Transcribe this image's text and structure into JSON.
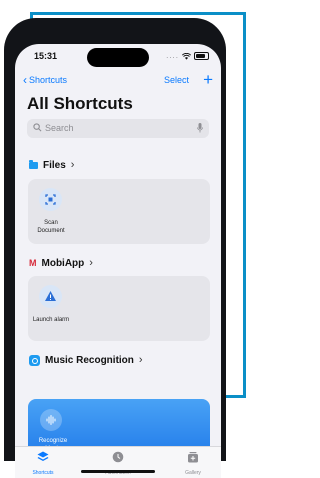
{
  "status": {
    "time": "15:31",
    "dots": "...."
  },
  "nav": {
    "back_label": "Shortcuts",
    "select_label": "Select",
    "add_label": "+"
  },
  "title": "All Shortcuts",
  "search": {
    "placeholder": "Search"
  },
  "sections": [
    {
      "title": "Files",
      "tiles": [
        {
          "label": "Scan Document",
          "icon": "scan-document-icon"
        }
      ]
    },
    {
      "title": "MobiApp",
      "tiles": [
        {
          "label": "Launch alarm",
          "icon": "warning-icon"
        }
      ]
    },
    {
      "title": "Music Recognition",
      "tiles": [
        {
          "label": "Recognize Music",
          "icon": "waveform-icon"
        }
      ]
    }
  ],
  "tabs": [
    {
      "label": "Shortcuts",
      "active": true
    },
    {
      "label": "Automation",
      "active": false
    },
    {
      "label": "Gallery",
      "active": false
    }
  ],
  "colors": {
    "accent": "#0a7aff",
    "frame": "#0b8fc7",
    "music_card": "#2e8cf0"
  }
}
